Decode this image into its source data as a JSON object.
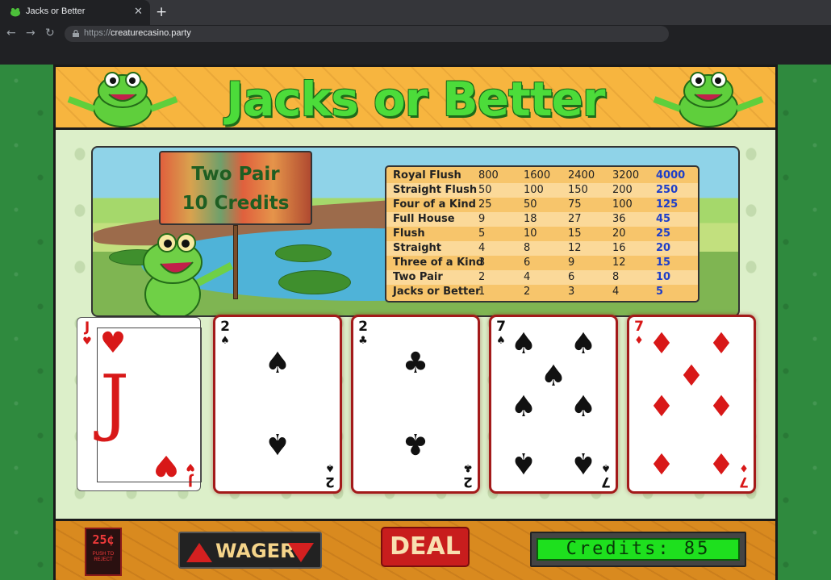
{
  "browser": {
    "tab_title": "Jacks or Better",
    "url_scheme": "https://",
    "url_host": "creaturecasino.party"
  },
  "game": {
    "title": "Jacks or Better",
    "sign": {
      "line1": "Two Pair",
      "line2": "10 Credits"
    },
    "paytable": {
      "rows": [
        {
          "hand": "Royal Flush",
          "pays": [
            "800",
            "1600",
            "2400",
            "3200",
            "4000"
          ]
        },
        {
          "hand": "Straight Flush",
          "pays": [
            "50",
            "100",
            "150",
            "200",
            "250"
          ]
        },
        {
          "hand": "Four of a Kind",
          "pays": [
            "25",
            "50",
            "75",
            "100",
            "125"
          ]
        },
        {
          "hand": "Full House",
          "pays": [
            "9",
            "18",
            "27",
            "36",
            "45"
          ]
        },
        {
          "hand": "Flush",
          "pays": [
            "5",
            "10",
            "15",
            "20",
            "25"
          ]
        },
        {
          "hand": "Straight",
          "pays": [
            "4",
            "8",
            "12",
            "16",
            "20"
          ]
        },
        {
          "hand": "Three of a Kind",
          "pays": [
            "3",
            "6",
            "9",
            "12",
            "15"
          ]
        },
        {
          "hand": "Two Pair",
          "pays": [
            "2",
            "4",
            "6",
            "8",
            "10"
          ]
        },
        {
          "hand": "Jacks or Better",
          "pays": [
            "1",
            "2",
            "3",
            "4",
            "5"
          ]
        }
      ]
    },
    "cards": [
      {
        "rank": "J",
        "suit": "♥",
        "color": "red"
      },
      {
        "rank": "2",
        "suit": "♠",
        "color": "black"
      },
      {
        "rank": "2",
        "suit": "♣",
        "color": "black"
      },
      {
        "rank": "7",
        "suit": "♠",
        "color": "black"
      },
      {
        "rank": "7",
        "suit": "♦",
        "color": "red"
      }
    ],
    "controls": {
      "chip_value": "25¢",
      "chip_caption": "PUSH TO REJECT",
      "wager_label": "WAGER",
      "deal_label": "DEAL",
      "credits_display": "Credits: 85"
    }
  }
}
